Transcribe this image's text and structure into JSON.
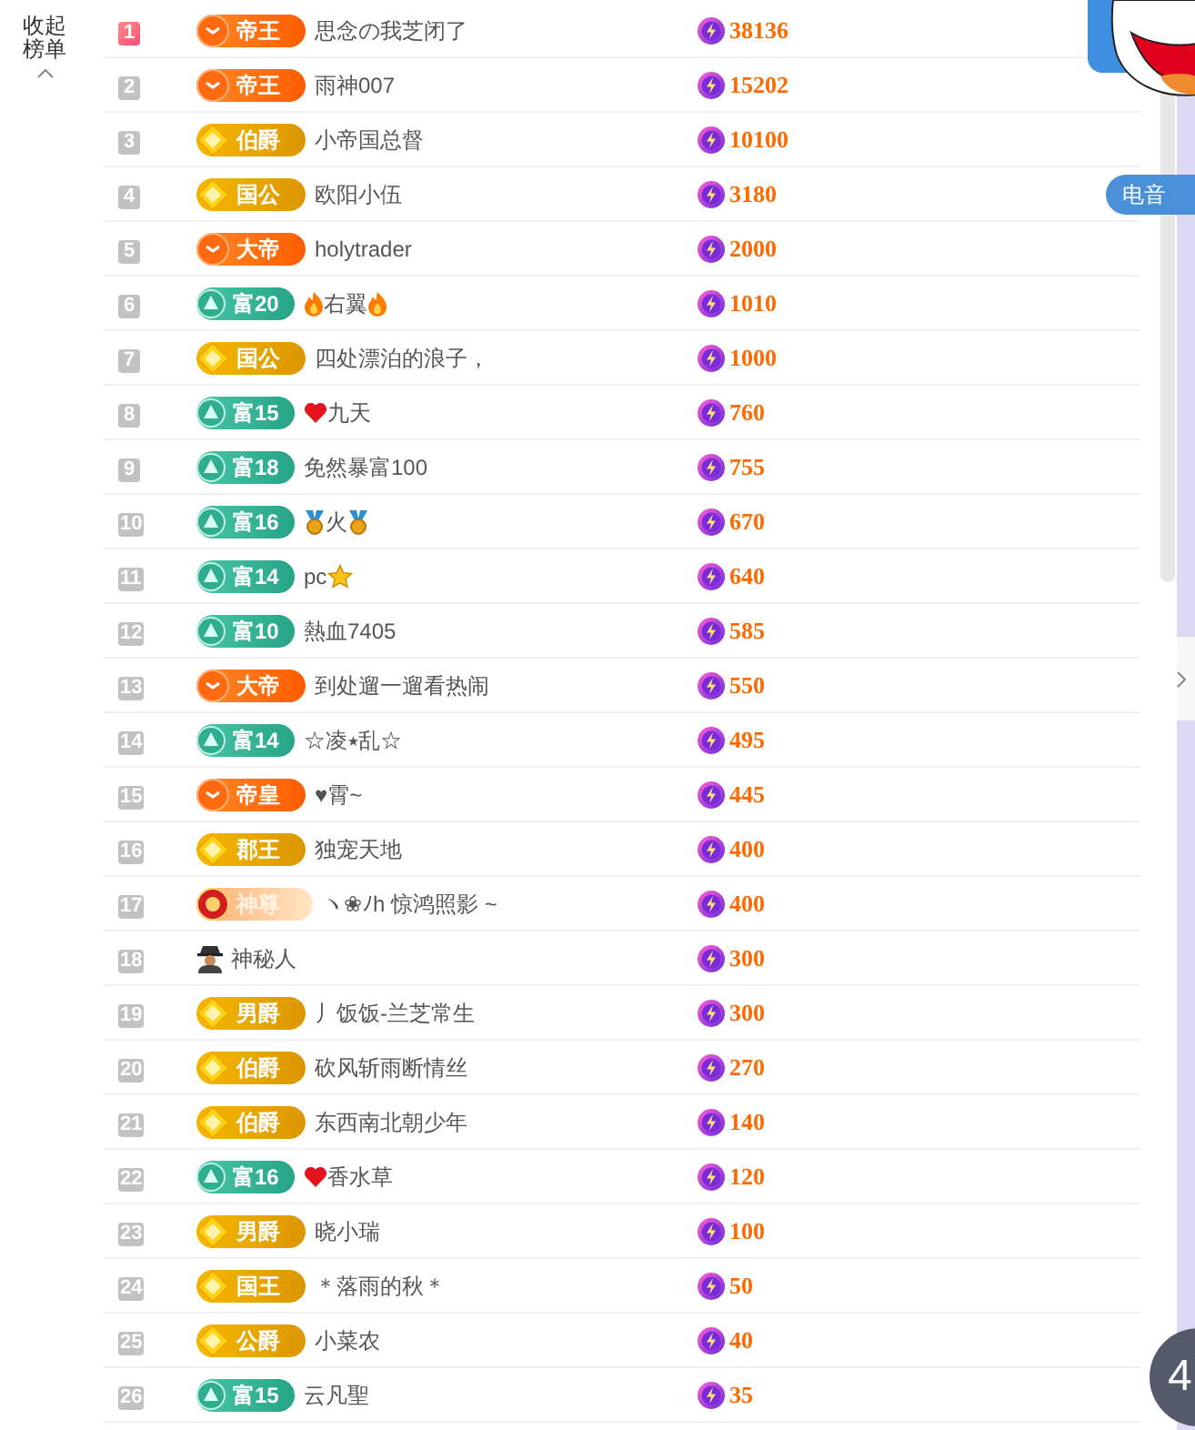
{
  "sidebar": {
    "collapse_label": "收起榜单"
  },
  "side_tab": {
    "label": "电音"
  },
  "floating_button": {
    "label": "4"
  },
  "rows": [
    {
      "rank": "1",
      "highlighted": true,
      "badge": {
        "kind": "orange",
        "label": "帝王"
      },
      "name": "思念の我芝闭了",
      "score": "38136"
    },
    {
      "rank": "2",
      "highlighted": false,
      "badge": {
        "kind": "orange",
        "label": "帝王"
      },
      "name": "雨神007",
      "score": "15202"
    },
    {
      "rank": "3",
      "highlighted": false,
      "badge": {
        "kind": "gold",
        "label": "伯爵"
      },
      "name": "小帝国总督",
      "score": "10100"
    },
    {
      "rank": "4",
      "highlighted": false,
      "badge": {
        "kind": "gold",
        "label": "国公"
      },
      "name": "欧阳小伍",
      "score": "3180"
    },
    {
      "rank": "5",
      "highlighted": false,
      "badge": {
        "kind": "orange",
        "label": "大帝"
      },
      "name": "holytrader",
      "score": "2000"
    },
    {
      "rank": "6",
      "highlighted": false,
      "badge": {
        "kind": "teal",
        "label": "富20"
      },
      "icons_before": [
        {
          "kind": "fire"
        }
      ],
      "name": "右翼",
      "icons_after": [
        {
          "kind": "fire"
        }
      ],
      "score": "1010"
    },
    {
      "rank": "7",
      "highlighted": false,
      "badge": {
        "kind": "gold",
        "label": "国公"
      },
      "name": "四处漂泊的浪子，",
      "score": "1000"
    },
    {
      "rank": "8",
      "highlighted": false,
      "badge": {
        "kind": "teal",
        "label": "富15"
      },
      "icons_before": [
        {
          "kind": "heart"
        }
      ],
      "name": "九天",
      "score": "760"
    },
    {
      "rank": "9",
      "highlighted": false,
      "badge": {
        "kind": "teal",
        "label": "富18"
      },
      "name": "免然暴富100",
      "score": "755"
    },
    {
      "rank": "10",
      "highlighted": false,
      "badge": {
        "kind": "teal",
        "label": "富16"
      },
      "icons_before": [
        {
          "kind": "medal"
        }
      ],
      "name": "火",
      "icons_after": [
        {
          "kind": "medal"
        }
      ],
      "score": "670"
    },
    {
      "rank": "11",
      "highlighted": false,
      "badge": {
        "kind": "teal",
        "label": "富14"
      },
      "name": "pc",
      "icons_after": [
        {
          "kind": "star"
        }
      ],
      "score": "640"
    },
    {
      "rank": "12",
      "highlighted": false,
      "badge": {
        "kind": "teal",
        "label": "富10"
      },
      "name": "熱血7405",
      "score": "585"
    },
    {
      "rank": "13",
      "highlighted": false,
      "badge": {
        "kind": "orange",
        "label": "大帝"
      },
      "name": "到处遛一遛看热闹",
      "score": "550"
    },
    {
      "rank": "14",
      "highlighted": false,
      "badge": {
        "kind": "teal",
        "label": "富14"
      },
      "name": "☆凌⭑乱☆",
      "score": "495"
    },
    {
      "rank": "15",
      "highlighted": false,
      "badge": {
        "kind": "orange",
        "label": "帝皇"
      },
      "name": "♥霄~",
      "score": "445"
    },
    {
      "rank": "16",
      "highlighted": false,
      "badge": {
        "kind": "gold",
        "label": "郡王"
      },
      "name": "独宠天地",
      "score": "400"
    },
    {
      "rank": "17",
      "highlighted": false,
      "badge": {
        "kind": "special",
        "label": "神尊"
      },
      "name": "ヽ❀ﾉh 惊鸿照影 ~",
      "score": "400"
    },
    {
      "rank": "18",
      "highlighted": false,
      "badge": {
        "kind": "incognito"
      },
      "name": "神秘人",
      "score": "300"
    },
    {
      "rank": "19",
      "highlighted": false,
      "badge": {
        "kind": "gold",
        "label": "男爵"
      },
      "name": "丿饭饭-兰芝常生",
      "score": "300"
    },
    {
      "rank": "20",
      "highlighted": false,
      "badge": {
        "kind": "gold",
        "label": "伯爵"
      },
      "name": "砍风斩雨断情丝",
      "score": "270"
    },
    {
      "rank": "21",
      "highlighted": false,
      "badge": {
        "kind": "gold",
        "label": "伯爵"
      },
      "name": "东西南北朝少年",
      "score": "140"
    },
    {
      "rank": "22",
      "highlighted": false,
      "badge": {
        "kind": "teal",
        "label": "富16"
      },
      "icons_before": [
        {
          "kind": "heart"
        }
      ],
      "name": "香水草",
      "score": "120"
    },
    {
      "rank": "23",
      "highlighted": false,
      "badge": {
        "kind": "gold",
        "label": "男爵"
      },
      "name": "晓小瑞",
      "score": "100"
    },
    {
      "rank": "24",
      "highlighted": false,
      "badge": {
        "kind": "gold",
        "label": "国王"
      },
      "name": "＊落雨的秋＊",
      "score": "50"
    },
    {
      "rank": "25",
      "highlighted": false,
      "badge": {
        "kind": "gold",
        "label": "公爵"
      },
      "name": "小菜农",
      "score": "40"
    },
    {
      "rank": "26",
      "highlighted": false,
      "badge": {
        "kind": "teal",
        "label": "富15"
      },
      "name": "云凡聖",
      "score": "35"
    }
  ]
}
